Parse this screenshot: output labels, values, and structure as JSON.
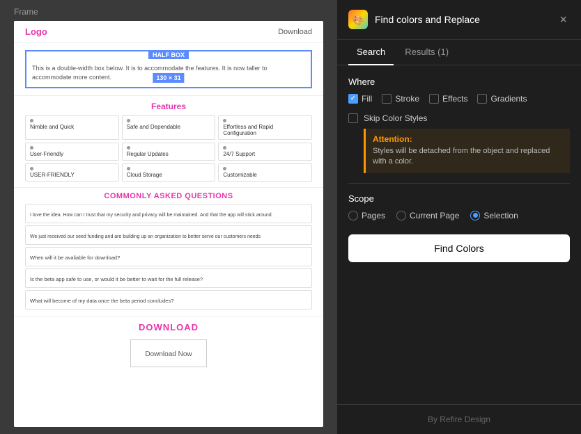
{
  "canvas": {
    "frame_label": "Frame",
    "topbar": {
      "logo": "Logo",
      "download_link": "Download"
    },
    "half_box": {
      "label": "HALF BOX",
      "size": "130 × 31",
      "description": "This is a double-width box below. It is to accommodate the features.\nIt is now taller to accommodate more content."
    },
    "features": {
      "title": "Features",
      "items": [
        {
          "dot": true,
          "name": "Nimble and Quick"
        },
        {
          "dot": true,
          "name": "Safe and Dependable"
        },
        {
          "dot": true,
          "name": "Effortless and Rapid Configuration"
        },
        {
          "dot": true,
          "name": "User-Friendly"
        },
        {
          "dot": true,
          "name": "Regular Updates"
        },
        {
          "dot": true,
          "name": "24/7 Support"
        },
        {
          "dot": true,
          "name": "USER-FRIENDLY"
        },
        {
          "dot": true,
          "name": "Cloud Storage"
        },
        {
          "dot": true,
          "name": "Customizable"
        }
      ]
    },
    "faq": {
      "title": "COMMONLY ASKED QUESTIONS",
      "intro": "I love the idea. How can I trust that my security and privacy will be maintained. And that the app will stick around.",
      "intro2": "We just received our seed funding and are building up an organization to better serve our customers needs",
      "questions": [
        "When will it be avaliable for download?",
        "Is the beta app safe to use, or would it be better to wait for the full release?",
        "What will become of my data once the beta period concludes?"
      ]
    },
    "download": {
      "title": "DOWNLOAD",
      "button": "Download Now"
    }
  },
  "panel": {
    "title": "Find colors and Replace",
    "icon": "🎨",
    "close_label": "×",
    "tabs": [
      {
        "label": "Search",
        "active": true
      },
      {
        "label": "Results (1)",
        "active": false
      }
    ],
    "where": {
      "label": "Where",
      "fill": {
        "label": "Fill",
        "checked": true
      },
      "stroke": {
        "label": "Stroke",
        "checked": false
      },
      "effects": {
        "label": "Effects",
        "checked": false
      },
      "gradients": {
        "label": "Gradients",
        "checked": false
      }
    },
    "skip_color_styles": {
      "label": "Skip Color Styles",
      "checked": false,
      "attention_title": "Attention:",
      "attention_text": "Styles will be detached from the object and replaced with a color."
    },
    "scope": {
      "label": "Scope",
      "options": [
        {
          "label": "Pages",
          "selected": false
        },
        {
          "label": "Current Page",
          "selected": false
        },
        {
          "label": "Selection",
          "selected": true
        }
      ]
    },
    "find_colors_btn": "Find Colors",
    "footer": "By Refire Design"
  }
}
